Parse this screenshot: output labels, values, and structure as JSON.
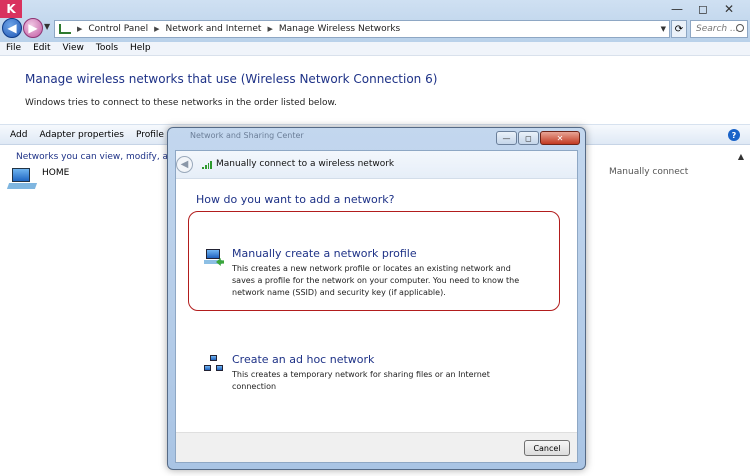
{
  "window": {
    "breadcrumb": [
      "Control Panel",
      "Network and Internet",
      "Manage Wireless Networks"
    ],
    "search_placeholder": "Search ...",
    "controls": {
      "minimize": "—",
      "maximize": "◻",
      "close": "✕"
    }
  },
  "menu": [
    "File",
    "Edit",
    "View",
    "Tools",
    "Help"
  ],
  "page": {
    "heading": "Manage wireless networks that use (Wireless Network Connection 6)",
    "subtext": "Windows tries to connect to these networks in the order listed below."
  },
  "toolbar": {
    "commands": [
      "Add",
      "Adapter properties",
      "Profile typ"
    ],
    "help": "?"
  },
  "network_list": {
    "group_header": "Networks you can view, modify, and rec",
    "items": [
      {
        "name": "HOME",
        "mode": "Manually connect"
      }
    ]
  },
  "dialog": {
    "title": "Network and Sharing Center",
    "nav_title": "Manually connect to a wireless network",
    "question": "How do you want to add a network?",
    "options": [
      {
        "title": "Manually create a network profile",
        "description": "This creates a new network profile or locates an existing network and saves a profile for the network on your computer. You need to know the network name (SSID) and security key (if applicable)."
      },
      {
        "title": "Create an ad hoc network",
        "description": "This creates a temporary network for sharing files or an Internet connection"
      }
    ],
    "cancel_label": "Cancel",
    "highlight_color": "#b21d1d"
  }
}
